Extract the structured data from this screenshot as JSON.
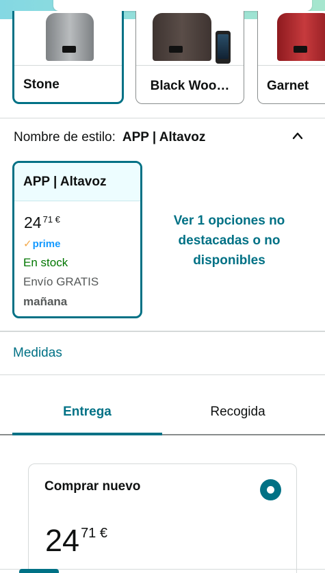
{
  "colors": {
    "accent": "#007185",
    "in_stock": "#007600",
    "prime": "#1399ff"
  },
  "swatches": [
    {
      "label": "Stone",
      "selected": true
    },
    {
      "label": "Black Woo…",
      "selected": false
    },
    {
      "label": "Garnet",
      "selected": false
    }
  ],
  "style": {
    "label": "Nombre de estilo:",
    "value": "APP | Altavoz"
  },
  "style_card": {
    "title": "APP | Altavoz",
    "price_whole": "24",
    "price_fraction": "71 €",
    "prime_check": "✓",
    "prime_label": "prime",
    "stock": "En stock",
    "shipping": "Envío GRATIS",
    "delivery_day": "mañana"
  },
  "more_options": "Ver 1 opciones no destacadas o no disponibles",
  "medidas": "Medidas",
  "tabs": [
    {
      "label": "Entrega",
      "active": true
    },
    {
      "label": "Recogida",
      "active": false
    }
  ],
  "buy_box": {
    "title": "Comprar nuevo",
    "price_whole": "24",
    "price_fraction": "71 €",
    "selected": true
  }
}
